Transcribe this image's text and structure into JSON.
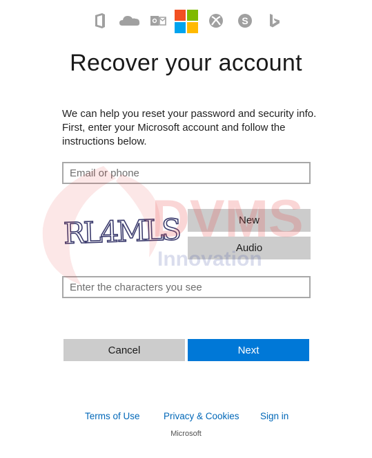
{
  "colors": {
    "accent": "#0078d7",
    "button_gray": "#cccccc",
    "link": "#0067b8",
    "ms_red": "#f25022",
    "ms_green": "#7fba00",
    "ms_blue": "#00a4ef",
    "ms_yellow": "#ffb900"
  },
  "header": {
    "product_icons": [
      "office-icon",
      "onedrive-icon",
      "outlook-icon",
      "microsoft-logo",
      "xbox-icon",
      "skype-icon",
      "bing-icon"
    ]
  },
  "page": {
    "title": "Recover your account",
    "intro": "We can help you reset your password and security info. First, enter your Microsoft account and follow the instructions below."
  },
  "form": {
    "email_placeholder": "Email or phone",
    "email_value": "",
    "captcha_text": "RL4MLS",
    "new_label": "New",
    "audio_label": "Audio",
    "captcha_placeholder": "Enter the characters you see",
    "captcha_value": "",
    "cancel_label": "Cancel",
    "next_label": "Next"
  },
  "watermark": {
    "line1": "DVMS",
    "line2": "Innovation"
  },
  "footer": {
    "terms": "Terms of Use",
    "privacy": "Privacy & Cookies",
    "signin": "Sign in",
    "brand": "Microsoft"
  }
}
